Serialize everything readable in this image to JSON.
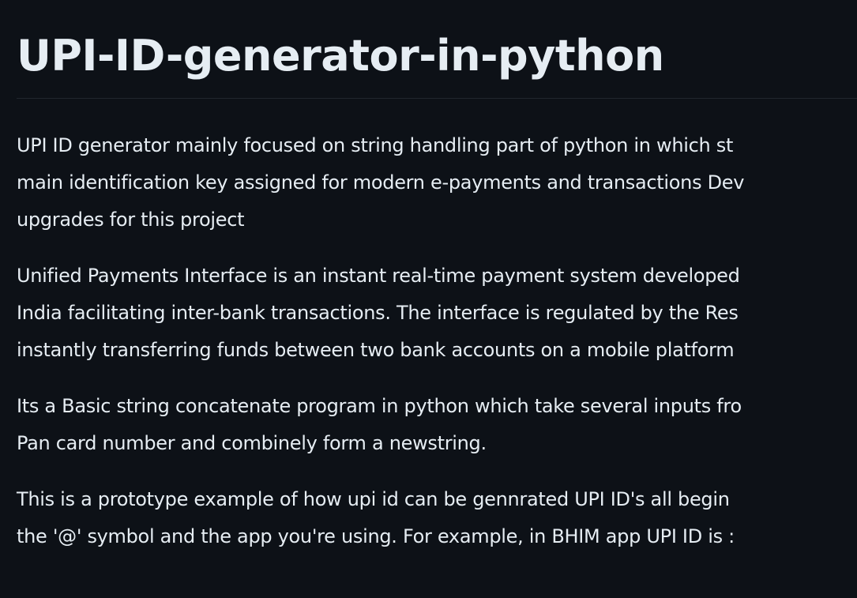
{
  "readme": {
    "title": "UPI-ID-generator-in-python",
    "paragraphs": [
      {
        "lines": [
          "UPI ID generator mainly focused on string handling part of python in which st",
          "main identification key assigned for modern e-payments and transactions Dev",
          "upgrades for this project"
        ]
      },
      {
        "lines": [
          "Unified Payments Interface is an instant real-time payment system developed",
          "India facilitating inter-bank transactions. The interface is regulated by the Res",
          "instantly transferring funds between two bank accounts on a mobile platform"
        ]
      },
      {
        "lines": [
          "Its a Basic string concatenate program in python which take several inputs fro",
          "Pan card number and combinely form a newstring."
        ]
      },
      {
        "lines": [
          "This is a prototype example of how upi id can be gennrated UPI ID's all begin",
          "the '@' symbol and the app you're using. For example, in BHIM app UPI ID is :"
        ]
      }
    ]
  }
}
